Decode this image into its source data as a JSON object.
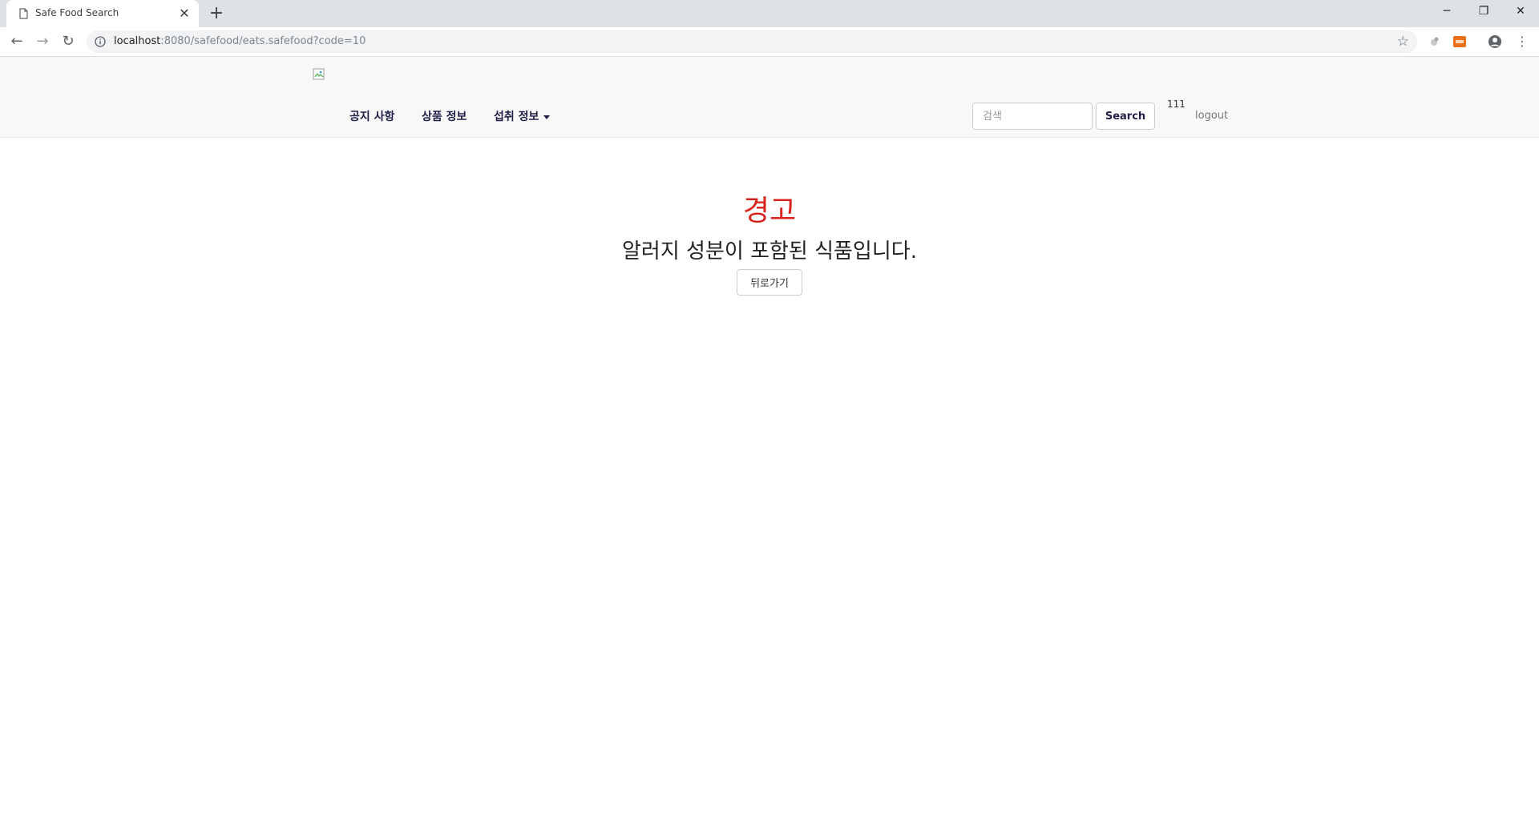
{
  "browser": {
    "tab_title": "Safe Food Search",
    "url_host": "localhost",
    "url_rest": ":8080/safefood/eats.safefood?code=10"
  },
  "navbar": {
    "menu": [
      "공지 사항",
      "상품 정보",
      "섭취 정보"
    ],
    "search_placeholder": "검색",
    "search_button": "Search",
    "user_id": "111",
    "logout": "logout"
  },
  "content": {
    "warning_title": "경고",
    "warning_message": "알러지 성분이 포함된 식품입니다.",
    "back_button": "뒤로가기"
  },
  "colors": {
    "warning": "#d9231d",
    "nav_text": "#1f1f47",
    "navbar_bg": "#f8f8f8"
  }
}
